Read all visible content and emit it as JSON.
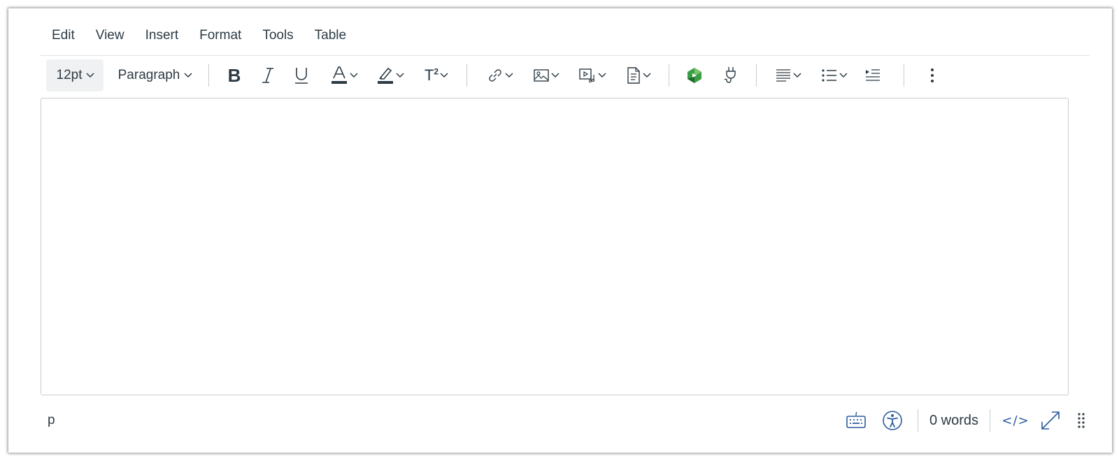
{
  "menubar": {
    "items": [
      "Edit",
      "View",
      "Insert",
      "Format",
      "Tools",
      "Table"
    ]
  },
  "toolbar": {
    "font_size": "12pt",
    "block_format": "Paragraph",
    "bold_label": "B",
    "superscript_label": "T",
    "superscript_exp": "2",
    "icons": {
      "bold": "bold-icon",
      "italic": "italic-icon",
      "underline": "underline-icon",
      "text_color": "text-color-icon",
      "highlight": "highlight-icon",
      "superscript": "superscript-icon",
      "link": "link-icon",
      "image": "image-icon",
      "media": "media-icon",
      "document": "document-icon",
      "app": "app-icon",
      "plug": "plug-icon",
      "align": "align-icon",
      "list": "list-icon",
      "indent": "indent-icon",
      "more": "more-vertical-icon"
    },
    "colors": {
      "icon": "#2d3b45",
      "app_green": "#3a9e45"
    }
  },
  "editor": {
    "content": ""
  },
  "statusbar": {
    "path": "p",
    "word_count": "0 words",
    "html_toggle": "</>",
    "icons": {
      "keyboard": "keyboard-icon",
      "accessibility": "accessibility-icon",
      "fullscreen": "fullscreen-icon",
      "resize": "resize-handle-icon"
    },
    "colors": {
      "accent": "#2b5b9f"
    }
  }
}
